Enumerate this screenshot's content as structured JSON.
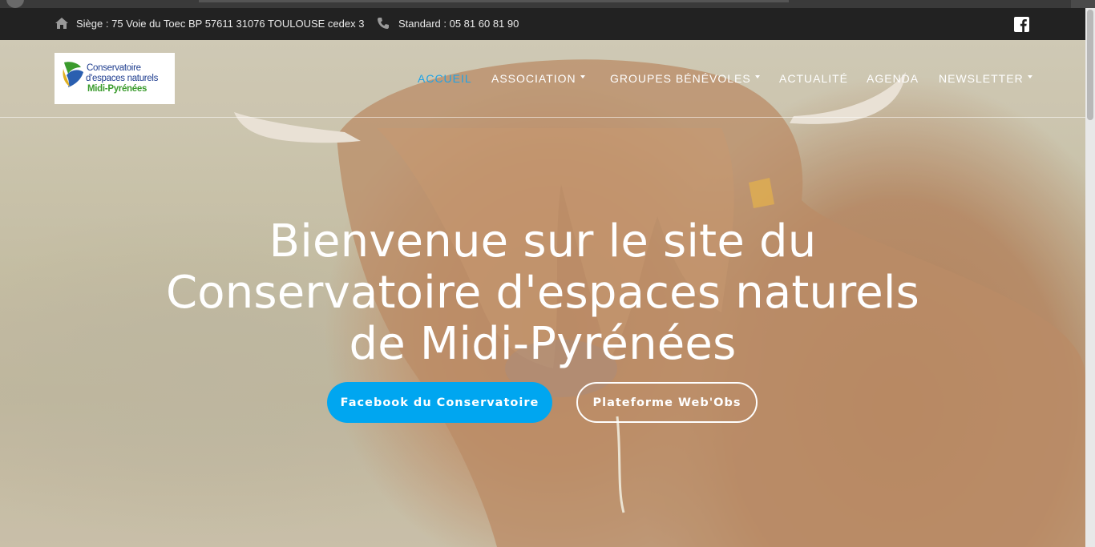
{
  "topbar": {
    "address": "Siège : 75 Voie du Toec BP 57611 31076 TOULOUSE cedex 3",
    "phone": "Standard : 05 81 60 81 90",
    "address_icon": "home-icon",
    "phone_icon": "phone-icon",
    "social_icon": "facebook-icon"
  },
  "logo": {
    "line1": "Conservatoire",
    "line2": "d'espaces naturels",
    "line3": "Midi-Pyrénées"
  },
  "nav": {
    "items": [
      {
        "label": "ACCUEIL",
        "active": true,
        "dropdown": false
      },
      {
        "label": "ASSOCIATION",
        "active": false,
        "dropdown": true
      },
      {
        "label": "GROUPES BÉNÉVOLES",
        "active": false,
        "dropdown": true
      },
      {
        "label": "ACTUALITÉ",
        "active": false,
        "dropdown": false
      },
      {
        "label": "AGENDA",
        "active": false,
        "dropdown": false
      },
      {
        "label": "NEWSLETTER",
        "active": false,
        "dropdown": true
      }
    ]
  },
  "hero": {
    "title_lines": [
      "Bienvenue sur le site du",
      "Conservatoire d'espaces naturels",
      "de Midi-Pyrénées"
    ],
    "primary_button": "Facebook du Conservatoire",
    "secondary_button": "Plateforme Web'Obs"
  },
  "colors": {
    "accent": "#00a6f0",
    "active_nav": "#1fa3e6",
    "topbar_bg": "#222222"
  }
}
